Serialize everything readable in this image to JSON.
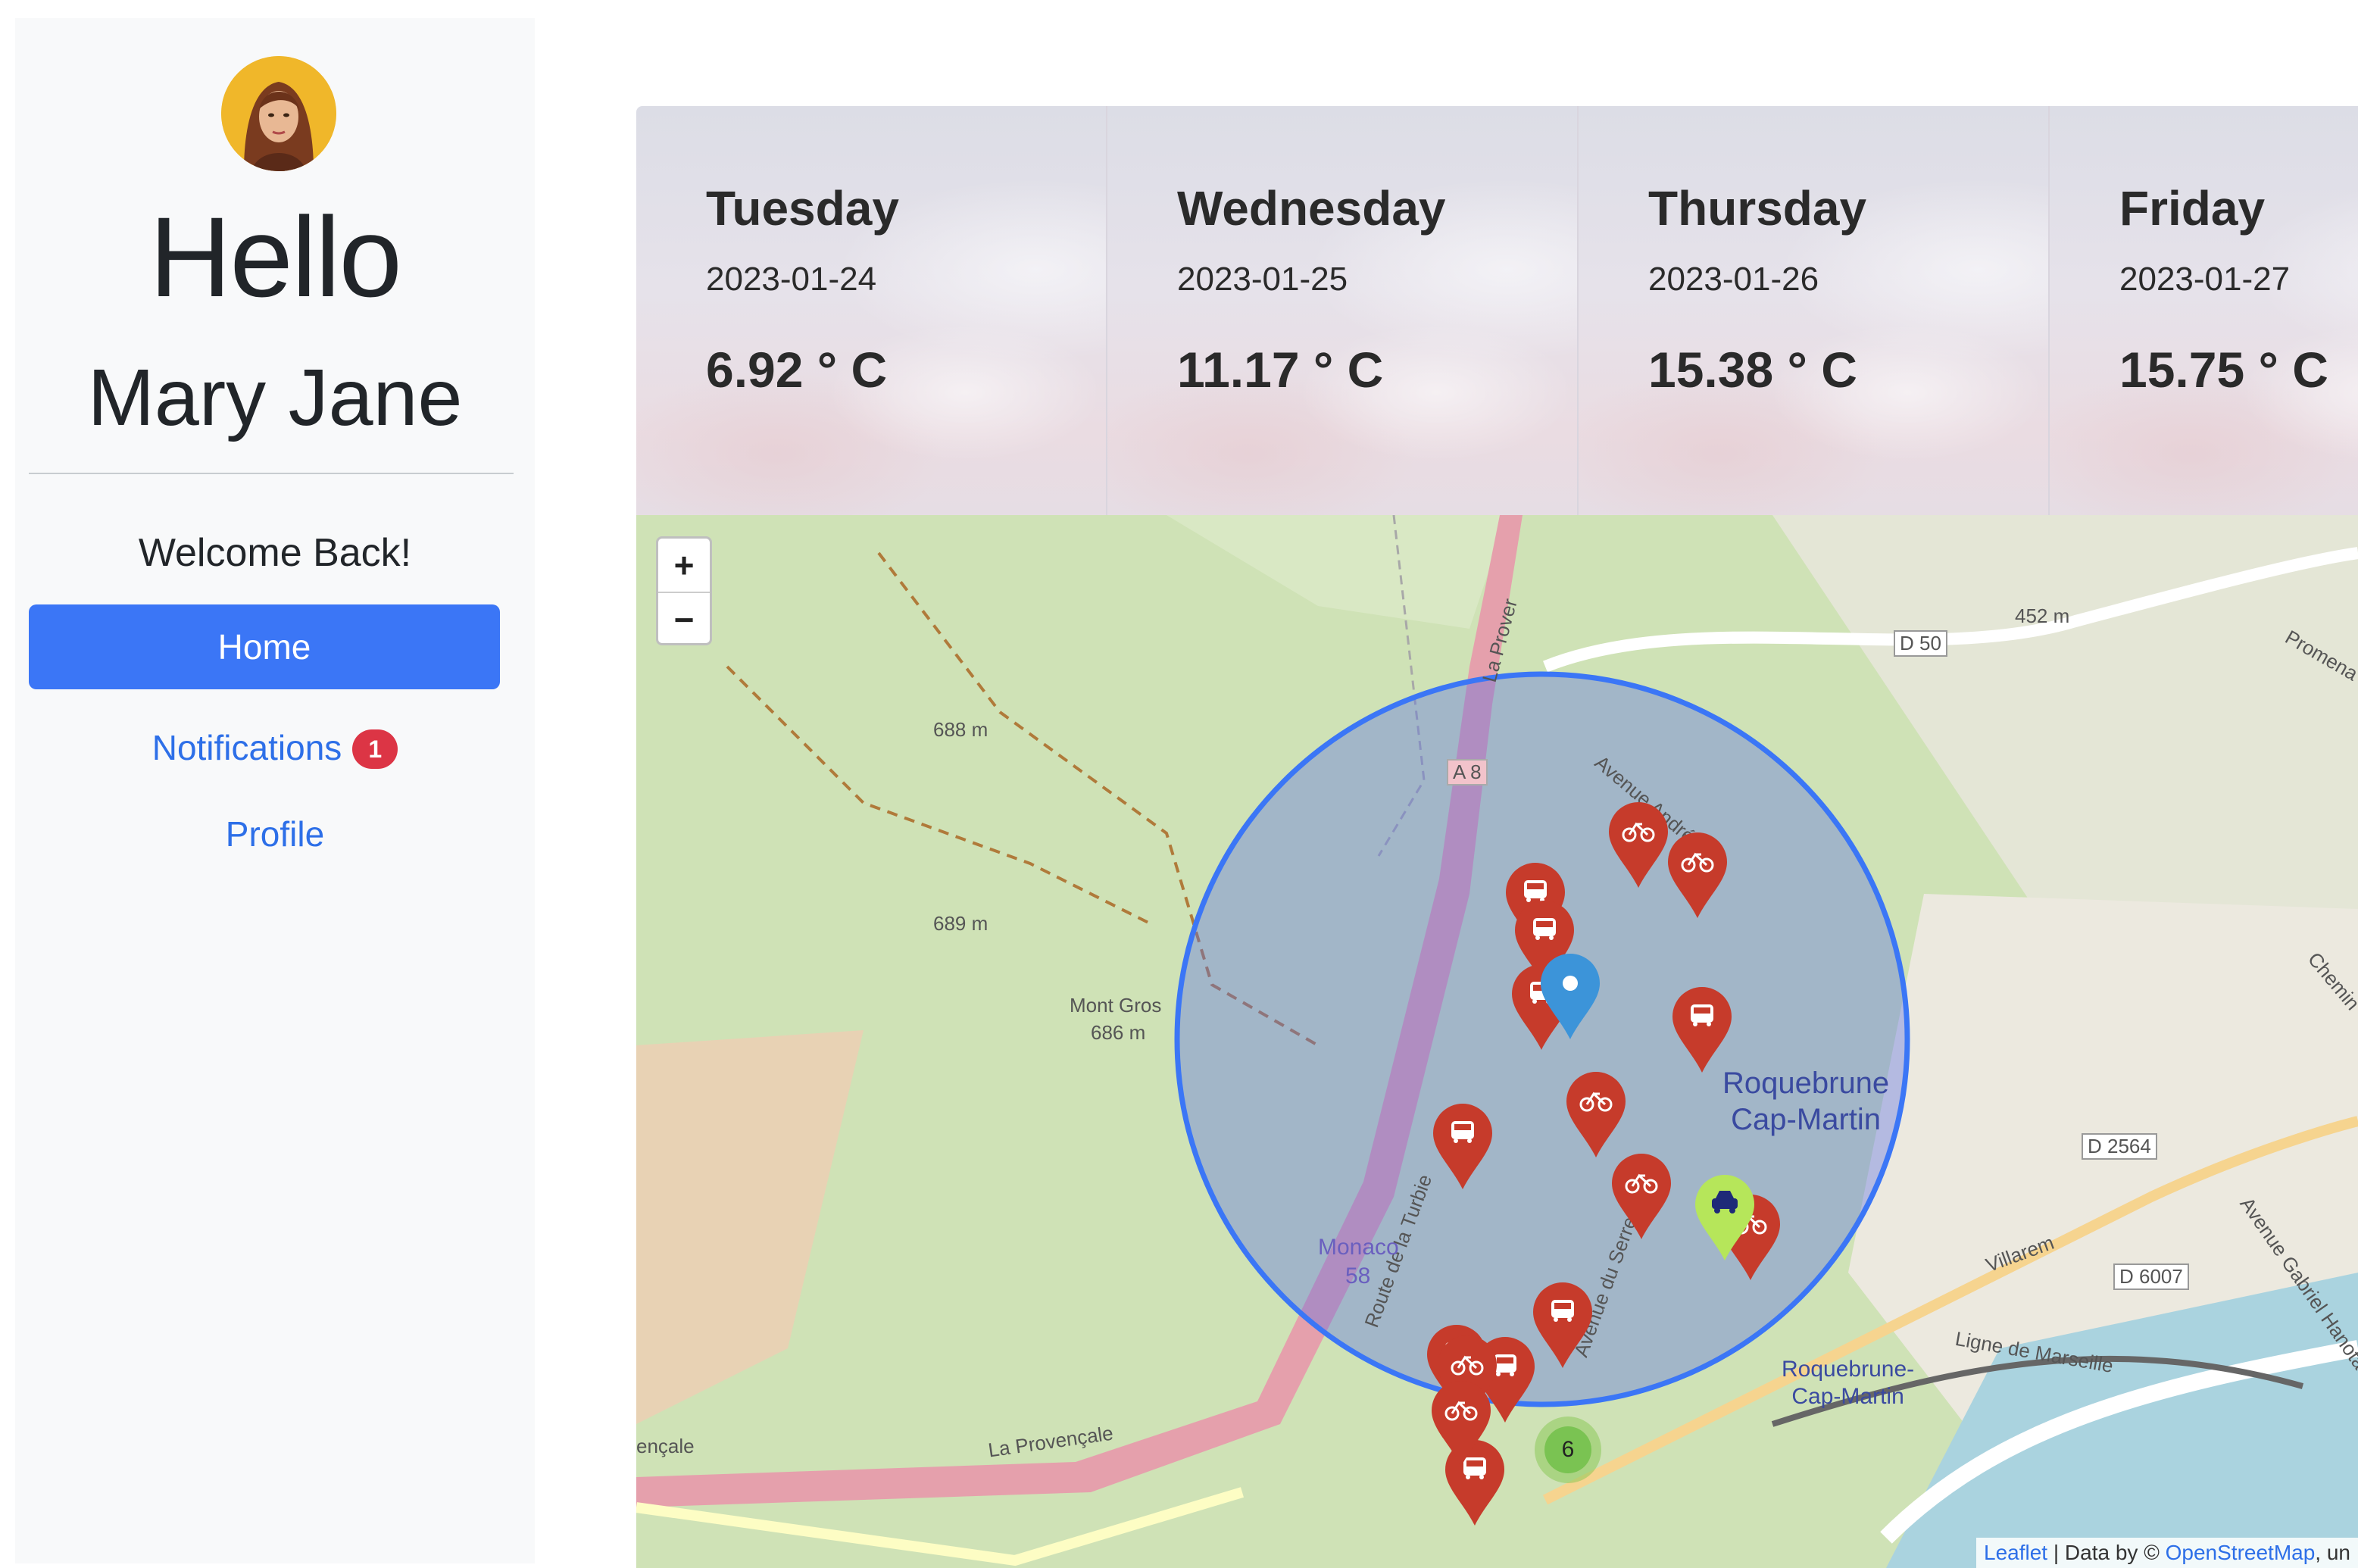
{
  "sidebar": {
    "greeting": "Hello",
    "user_name": "Mary Jane",
    "welcome": "Welcome Back!",
    "nav": {
      "home": "Home",
      "notifications": "Notifications",
      "notifications_count": "1",
      "profile": "Profile"
    }
  },
  "forecast": [
    {
      "day": "Tuesday",
      "date": "2023-01-24",
      "temp": "6.92 ° C"
    },
    {
      "day": "Wednesday",
      "date": "2023-01-25",
      "temp": "11.17 ° C"
    },
    {
      "day": "Thursday",
      "date": "2023-01-26",
      "temp": "15.38 ° C"
    },
    {
      "day": "Friday",
      "date": "2023-01-27",
      "temp": "15.75 ° C"
    }
  ],
  "map": {
    "zoom_in": "+",
    "zoom_out": "−",
    "attribution": {
      "leaflet": "Leaflet",
      "separator": " | Data by © ",
      "osm": "OpenStreetMap",
      "suffix": ", un"
    },
    "labels": {
      "peak1": "688 m",
      "peak2": "689 m",
      "mont_gros": "Mont Gros",
      "mont_gros_alt": "686 m",
      "alt452": "452 m",
      "d50": "D 50",
      "a8": "A 8",
      "d2564": "D 2564",
      "d6007": "D 6007",
      "la_provencale": "La Provençale",
      "encale": "ençale",
      "monaco": "Monaco",
      "monaco_num": "58",
      "roquebrune_main_1": "Roquebrune",
      "roquebrune_main_2": "Cap-Martin",
      "roquebrune_station_1": "Roquebrune-",
      "roquebrune_station_2": "Cap-Martin",
      "ligne": "Ligne de Marseille",
      "route": "Route de la Turbie",
      "avenue_serret": "Avenue du Serret",
      "avenue_andre": "Avenue André",
      "la_prover": "La Prover",
      "villarem": "Villarem",
      "promena": "Promena",
      "chemin": "Chemin",
      "avenue_gabriel": "Avenue Gabriel Hanotaux"
    },
    "cluster_count": "6",
    "marker_icons": [
      "bus-icon",
      "bike-icon",
      "taxi-icon",
      "location-icon"
    ],
    "colors": {
      "marker": "#c63b2b",
      "taxi_marker": "#b6e65a",
      "radius_circle": "#3b76f6"
    }
  }
}
